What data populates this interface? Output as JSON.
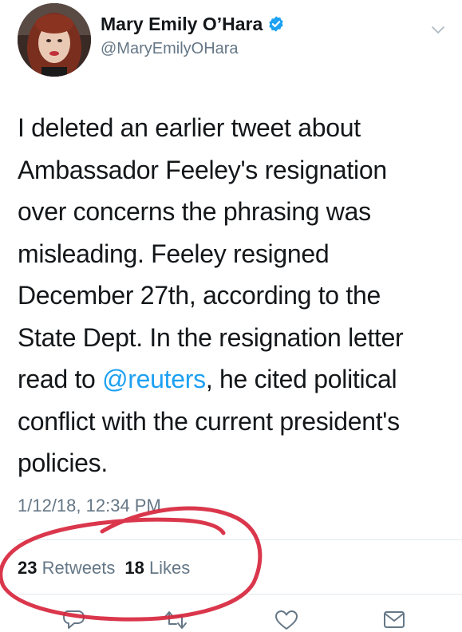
{
  "author": {
    "display_name": "Mary Emily O’Hara",
    "handle": "@MaryEmilyOHara",
    "verified": true
  },
  "tweet": {
    "lines": [
      [
        "I deleted an earlier tweet about"
      ],
      [
        "Ambassador Feeley's resignation"
      ],
      [
        "over concerns the phrasing was"
      ],
      [
        "misleading. Feeley resigned"
      ],
      [
        "December 27th, according to the"
      ],
      [
        "State Dept. In the resignation letter"
      ],
      [
        "read to ",
        "@reuters",
        ", he cited political"
      ],
      [
        "conflict with the current president's"
      ],
      [
        "policies."
      ]
    ],
    "mention": "@reuters",
    "timestamp": "1/12/18, 12:34 PM"
  },
  "stats": {
    "retweets_count": "23",
    "retweets_label": "Retweets",
    "likes_count": "18",
    "likes_label": "Likes"
  },
  "icons": {
    "reply": "reply-icon",
    "retweet": "retweet-icon",
    "like": "heart-icon",
    "message": "envelope-icon",
    "verified": "verified-badge-icon",
    "menu": "chevron-down-icon"
  },
  "colors": {
    "text": "#14171a",
    "secondary": "#657786",
    "link": "#1da1f2",
    "verified": "#1da1f2",
    "annotation": "#d7263d"
  }
}
